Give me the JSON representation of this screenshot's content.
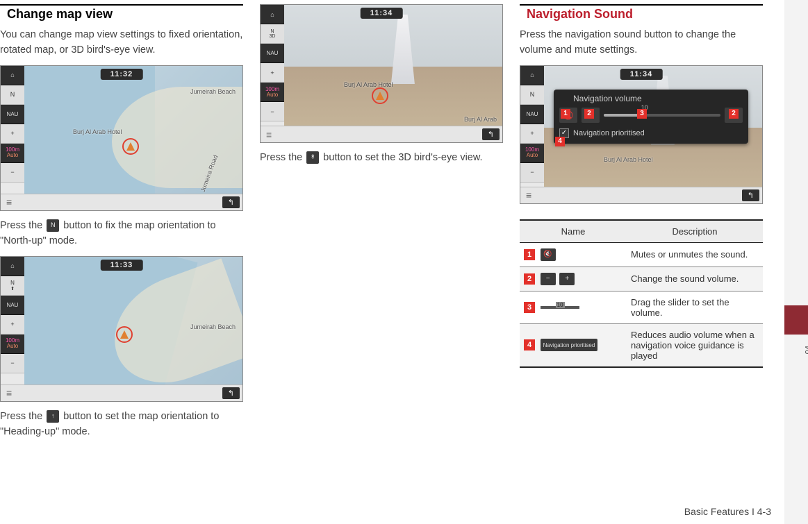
{
  "col1": {
    "heading": "Change map view",
    "intro": "You can change map view settings to fixed orientation, rotated map, or 3D bird's-eye view.",
    "shot1": {
      "clock": "11:32",
      "poi1": "Jumeirah Beach",
      "poi2": "Burj Al Arab Hotel",
      "poi3": "Jumeira Road",
      "scaleTop": "100m",
      "scaleAuto": "Auto"
    },
    "text1a": "Press the ",
    "text1b": " button to fix the map orientation to \"North-up\" mode.",
    "shot2": {
      "clock": "11:33",
      "poi": "Jumeirah Beach"
    },
    "text2a": "Press the ",
    "text2b": " button to set the map orientation to \"Heading-up\" mode."
  },
  "col2": {
    "shot": {
      "clock": "11:34",
      "poi": "Burj Al Arab Hotel",
      "rightlabel": "Burj Al Arab"
    },
    "text_a": "Press the ",
    "text_b": " button to set the 3D bird's-eye view."
  },
  "col3": {
    "heading": "Navigation Sound",
    "intro": "Press the navigation sound button to change the volume and mute settings.",
    "shot": {
      "clock": "11:34",
      "overlay_title": "Navigation volume",
      "slider_value": "10",
      "check_label": "Navigation prioritised",
      "poi": "Burj Al Arab Hotel"
    },
    "table": {
      "head_name": "Name",
      "head_desc": "Description",
      "rows": [
        {
          "num": "1",
          "desc": "Mutes or unmutes the sound."
        },
        {
          "num": "2",
          "desc": "Change the sound volume."
        },
        {
          "num": "3",
          "desc": "Drag the slider to set the volume."
        },
        {
          "num": "4",
          "label": "Navigation prioritised",
          "desc": "Reduces audio volume when a navigation voice guidance is played"
        }
      ]
    }
  },
  "footer": "Basic Features I 4-3",
  "sidetab": "04",
  "icons": {
    "home": "⌂",
    "north": "N",
    "nau": "NAU",
    "plus": "+",
    "minus": "−",
    "menu": "≡",
    "back": "↰",
    "heading": "↑",
    "threeD": "↟",
    "mute": "🔇",
    "check": "✓"
  }
}
